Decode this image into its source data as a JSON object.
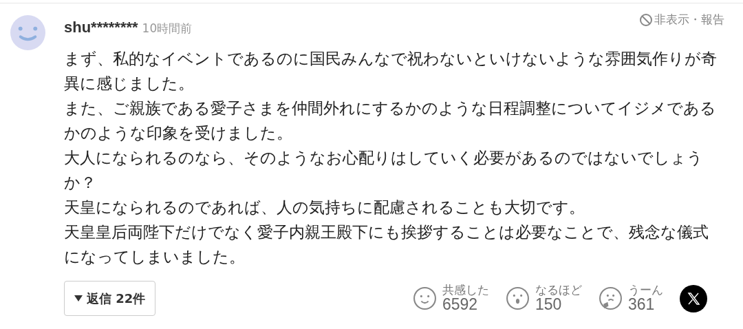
{
  "comment": {
    "author": "shu********",
    "time": "10時間前",
    "hide_report": "非表示・報告",
    "paragraphs": [
      "まず、私的なイベントであるのに国民みんなで祝わないといけないような雰囲気作りが奇異に感じました。",
      "また、ご親族である愛子さまを仲間外れにするかのような日程調整についてイジメであるかのような印象を受けました。",
      "大人になられるのなら、そのようなお心配りはしていく必要があるのではないでしょうか？",
      "天皇になられるのであれば、人の気持ちに配慮されることも大切です。",
      "天皇皇后両陛下だけでなく愛子内親王殿下にも挨拶することは必要なことで、残念な儀式になってしまいました。"
    ],
    "replies_button": "返信 22件",
    "reactions": [
      {
        "kind": "smile",
        "label": "共感した",
        "count": "6592"
      },
      {
        "kind": "surprise",
        "label": "なるほど",
        "count": "150"
      },
      {
        "kind": "think",
        "label": "うーん",
        "count": "361"
      }
    ]
  }
}
